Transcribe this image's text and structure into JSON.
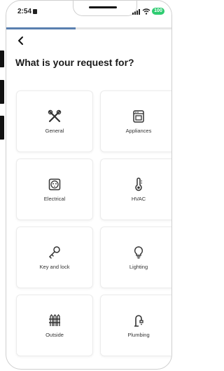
{
  "status_bar": {
    "time": "2:54",
    "battery": "100"
  },
  "progress_percent": 42,
  "header": {
    "title": "What is your request for?"
  },
  "categories": [
    {
      "label": "General",
      "icon": "tools-icon"
    },
    {
      "label": "Appliances",
      "icon": "oven-icon"
    },
    {
      "label": "Electrical",
      "icon": "outlet-icon"
    },
    {
      "label": "HVAC",
      "icon": "thermometer-icon"
    },
    {
      "label": "Key and lock",
      "icon": "key-icon"
    },
    {
      "label": "Lighting",
      "icon": "lightbulb-icon"
    },
    {
      "label": "Outside",
      "icon": "fence-icon"
    },
    {
      "label": "Plumbing",
      "icon": "faucet-icon"
    }
  ],
  "colors": {
    "accent": "#5a7fb0",
    "battery": "#2ecc71",
    "text": "#1b1b1b"
  }
}
